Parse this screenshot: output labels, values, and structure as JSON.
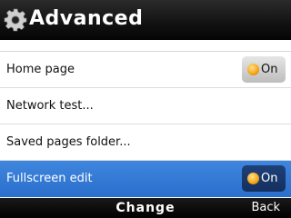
{
  "header": {
    "title": "Advanced",
    "icon": "gear-icon"
  },
  "colors": {
    "selected_row": "#3478d4",
    "toggle_on_dot": "#f3a614"
  },
  "settings": [
    {
      "label": "Home page",
      "toggle": "On"
    },
    {
      "label": "Network test..."
    },
    {
      "label": "Saved pages folder..."
    },
    {
      "label": "Fullscreen edit",
      "toggle": "On",
      "selected": true
    }
  ],
  "softkeys": {
    "center": "Change",
    "right": "Back"
  }
}
